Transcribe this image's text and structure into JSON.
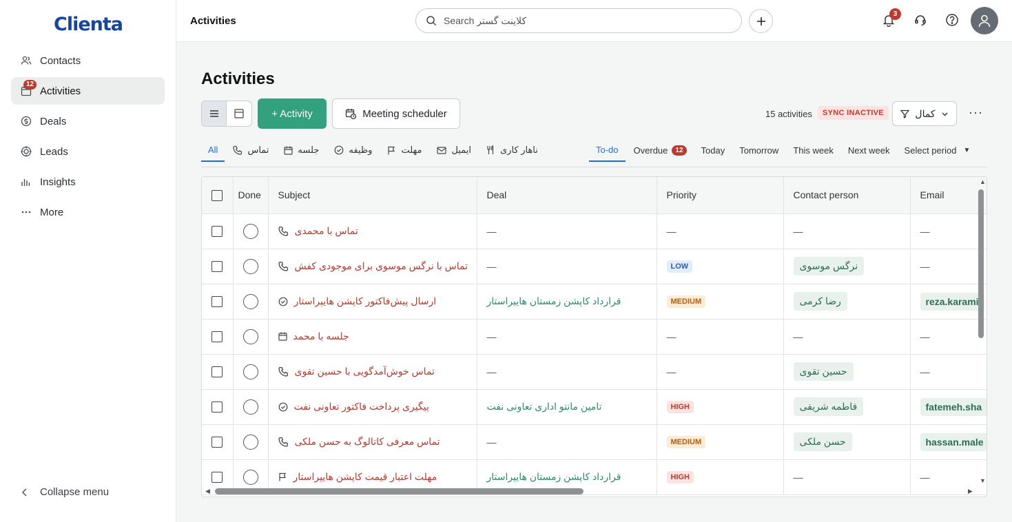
{
  "sidebar": {
    "logo": "Clienta",
    "items": [
      {
        "label": "Contacts",
        "icon": "contacts-icon"
      },
      {
        "label": "Activities",
        "icon": "calendar-icon",
        "badge": "12"
      },
      {
        "label": "Deals",
        "icon": "dollar-icon"
      },
      {
        "label": "Leads",
        "icon": "target-icon"
      },
      {
        "label": "Insights",
        "icon": "chart-icon"
      },
      {
        "label": "More",
        "icon": "ellipsis-icon"
      }
    ],
    "collapse_label": "Collapse menu"
  },
  "header": {
    "breadcrumb": "Activities",
    "search_placeholder": "Search کلاینت گستر",
    "bell_badge": "3"
  },
  "main": {
    "title": "Activities",
    "add_activity_label": "+ Activity",
    "meeting_label": "Meeting scheduler",
    "count_label": "15 activities",
    "sync_label": "SYNC INACTIVE",
    "filter_label": "کمال",
    "more_label": "···",
    "type_tabs": [
      {
        "label": "All"
      },
      {
        "label": "تماس"
      },
      {
        "label": "جلسه"
      },
      {
        "label": "وظیفه"
      },
      {
        "label": "مهلت"
      },
      {
        "label": "ایمیل"
      },
      {
        "label": "ناهار کاری"
      }
    ],
    "period_tabs": [
      {
        "label": "To-do"
      },
      {
        "label": "Overdue",
        "badge": "12"
      },
      {
        "label": "Today"
      },
      {
        "label": "Tomorrow"
      },
      {
        "label": "This week"
      },
      {
        "label": "Next week"
      },
      {
        "label": "Select period"
      }
    ]
  },
  "table": {
    "columns": [
      "Done",
      "Subject",
      "Deal",
      "Priority",
      "Contact person",
      "Email"
    ],
    "rows": [
      {
        "type": "call",
        "subject": "تماس با محمدی",
        "deal": "—",
        "priority": "—",
        "priority_class": "none",
        "contact": "—",
        "email": "—"
      },
      {
        "type": "call",
        "subject": "تماس با نرگس موسوی برای موجودی کفش",
        "deal": "—",
        "priority": "LOW",
        "priority_class": "low",
        "contact": "نرگس موسوی",
        "email": "—"
      },
      {
        "type": "task",
        "subject": "ارسال پیش‌فاکتور کاپشن هایپراستار",
        "deal": "قرارداد کاپشن زمستان هایپراستار",
        "priority": "MEDIUM",
        "priority_class": "medium",
        "contact": "رضا کرمی",
        "email": "reza.karami"
      },
      {
        "type": "meeting",
        "subject": "جلسه با محمد",
        "deal": "—",
        "priority": "—",
        "priority_class": "none",
        "contact": "—",
        "email": "—"
      },
      {
        "type": "call",
        "subject": "تماس خوش‌آمدگویی با حسین تقوی",
        "deal": "—",
        "priority": "—",
        "priority_class": "none",
        "contact": "حسین تقوی",
        "email": "—"
      },
      {
        "type": "task",
        "subject": "پیگیری پرداخت فاکتور تعاونی نفت",
        "deal": "تامین مانتو اداری تعاونی نفت",
        "priority": "HIGH",
        "priority_class": "high",
        "contact": "فاطمه شریفی",
        "email": "fatemeh.sha"
      },
      {
        "type": "call",
        "subject": "تماس معرفی کاتالوگ به حسن ملکی",
        "deal": "—",
        "priority": "MEDIUM",
        "priority_class": "medium",
        "contact": "حسن ملکی",
        "email": "hassan.male"
      },
      {
        "type": "deadline",
        "subject": "مهلت اعتبار قیمت کاپشن هایپراستار",
        "deal": "قرارداد کاپشن زمستان هایپراستار",
        "priority": "HIGH",
        "priority_class": "high",
        "contact": "—",
        "email": "—"
      }
    ]
  }
}
